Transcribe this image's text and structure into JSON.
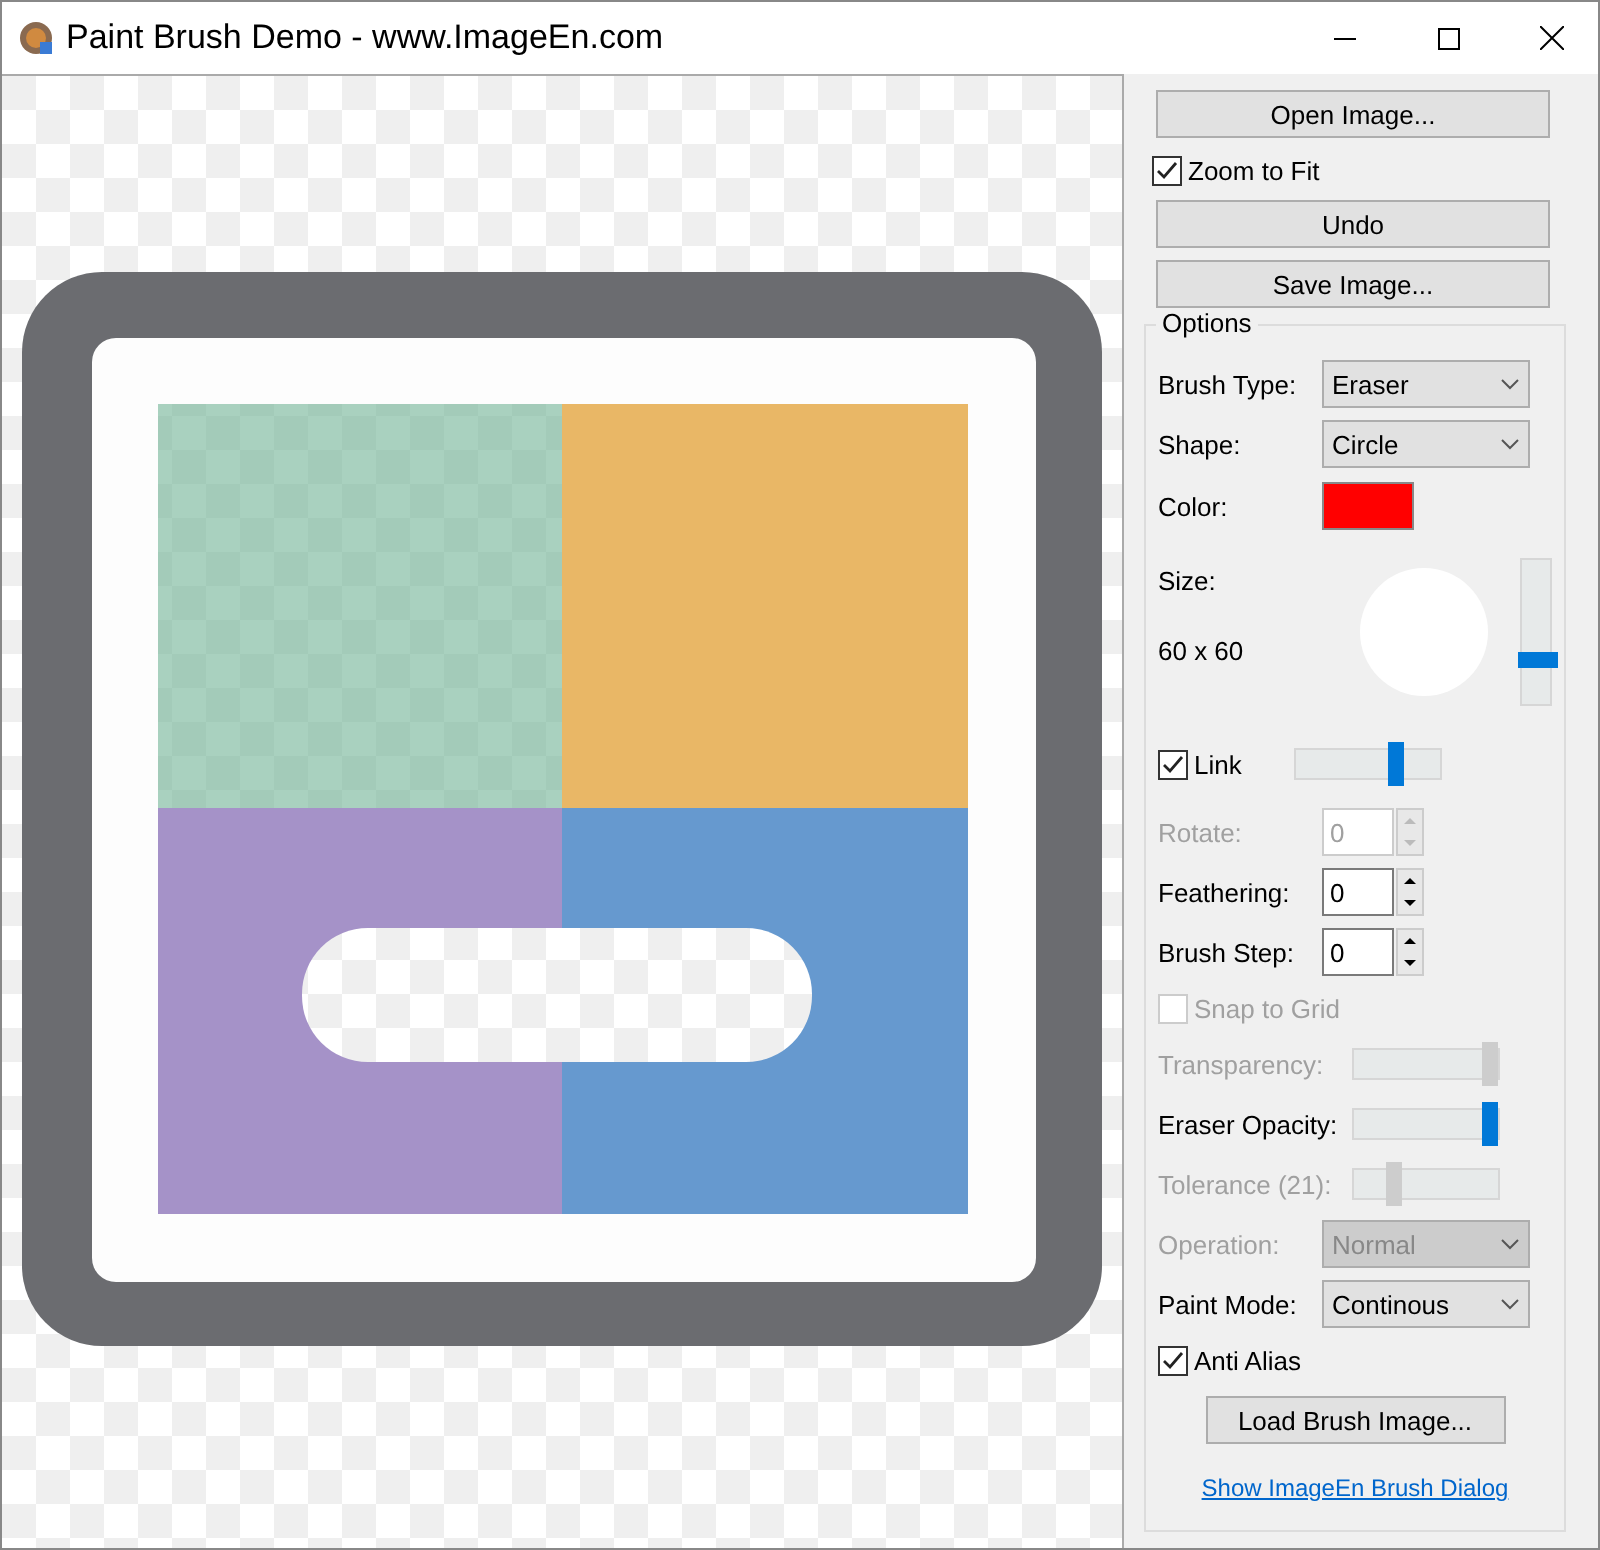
{
  "window": {
    "title": "Paint Brush Demo - www.ImageEn.com"
  },
  "sidebar": {
    "open_button": "Open Image...",
    "zoom_to_fit": {
      "label": "Zoom to Fit",
      "checked": true
    },
    "undo_button": "Undo",
    "save_button": "Save Image..."
  },
  "options": {
    "title": "Options",
    "rows": [
      {
        "kind": "select",
        "label": "Brush Type:",
        "value": "Eraser",
        "disabled": false
      },
      {
        "kind": "select",
        "label": "Shape:",
        "value": "Circle",
        "disabled": false
      },
      {
        "kind": "color",
        "label": "Color:",
        "color": "#ff0000"
      },
      {
        "kind": "size",
        "label": "Size:",
        "reading": "60 x 60",
        "level": 0.3
      },
      {
        "kind": "check_slider",
        "label": "Link",
        "checked": true,
        "level": 0.7
      },
      {
        "kind": "spin",
        "label": "Rotate:",
        "value": "0",
        "disabled": true
      },
      {
        "kind": "spin",
        "label": "Feathering:",
        "value": "0",
        "disabled": false
      },
      {
        "kind": "spin",
        "label": "Brush Step:",
        "value": "0",
        "disabled": false
      },
      {
        "kind": "checkbox",
        "label": "Snap to Grid",
        "checked": false,
        "disabled": true
      },
      {
        "kind": "slider",
        "label": "Transparency:",
        "level": 1,
        "disabled": true
      },
      {
        "kind": "slider",
        "label": "Eraser Opacity:",
        "level": 1,
        "disabled": false
      },
      {
        "kind": "slider",
        "label": "Tolerance (21):",
        "level": 0.25,
        "disabled": true
      },
      {
        "kind": "select",
        "label": "Operation:",
        "value": "Normal",
        "disabled": true
      },
      {
        "kind": "select",
        "label": "Paint Mode:",
        "value": "Continous",
        "disabled": false
      },
      {
        "kind": "checkbox",
        "label": "Anti Alias",
        "checked": true,
        "disabled": false
      },
      {
        "kind": "button",
        "label": "Load Brush Image..."
      },
      {
        "kind": "link",
        "label": "Show ImageEn Brush Dialog"
      }
    ]
  }
}
